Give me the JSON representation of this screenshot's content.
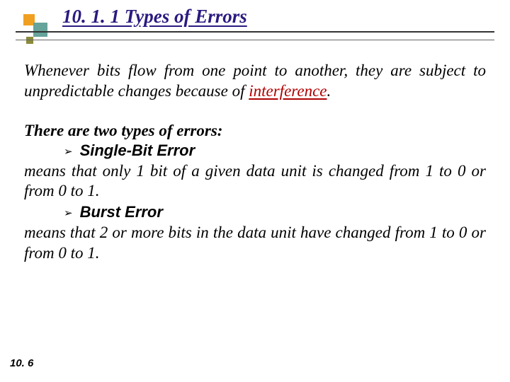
{
  "title": "10. 1. 1  Types of Errors",
  "para1_pre": "Whenever bits flow from one point to another, they are subject to unpredictable changes because of ",
  "para1_hi": "interference",
  "para1_post": ".",
  "lead2": "There are two types of errors:",
  "bullets": [
    {
      "label": "Single-Bit Error",
      "desc": "means that only 1 bit of a given data unit is changed from 1 to 0 or from 0 to 1."
    },
    {
      "label": "Burst Error",
      "desc": "means that 2 or more bits in the data unit have changed from 1 to 0 or from 0 to 1."
    }
  ],
  "footer": "10. 6"
}
